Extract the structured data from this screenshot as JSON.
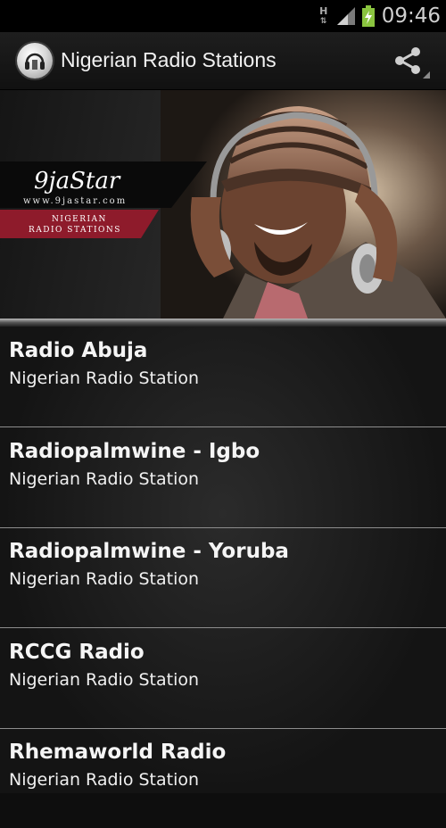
{
  "status_bar": {
    "network_type": "H",
    "clock": "09:46"
  },
  "action_bar": {
    "title": "Nigerian Radio Stations",
    "logo_icon": "radio-headphones-icon",
    "share_icon": "share-icon"
  },
  "banner": {
    "brand": "9jaStar",
    "url": "www.9jastar.com",
    "tagline_line1": "NIGERIAN",
    "tagline_line2": "RADIO STATIONS"
  },
  "stations": [
    {
      "name": "Radio Abuja",
      "subtitle": "Nigerian Radio Station"
    },
    {
      "name": "Radiopalmwine - Igbo",
      "subtitle": "Nigerian Radio Station"
    },
    {
      "name": "Radiopalmwine - Yoruba",
      "subtitle": "Nigerian Radio Station"
    },
    {
      "name": "RCCG Radio",
      "subtitle": "Nigerian Radio Station"
    },
    {
      "name": "Rhemaworld Radio",
      "subtitle": "Nigerian Radio Station"
    }
  ],
  "colors": {
    "banner_ribbon": "#8e1b2b",
    "battery_fill": "#8ac43f",
    "divider": "#8d8d8d"
  }
}
